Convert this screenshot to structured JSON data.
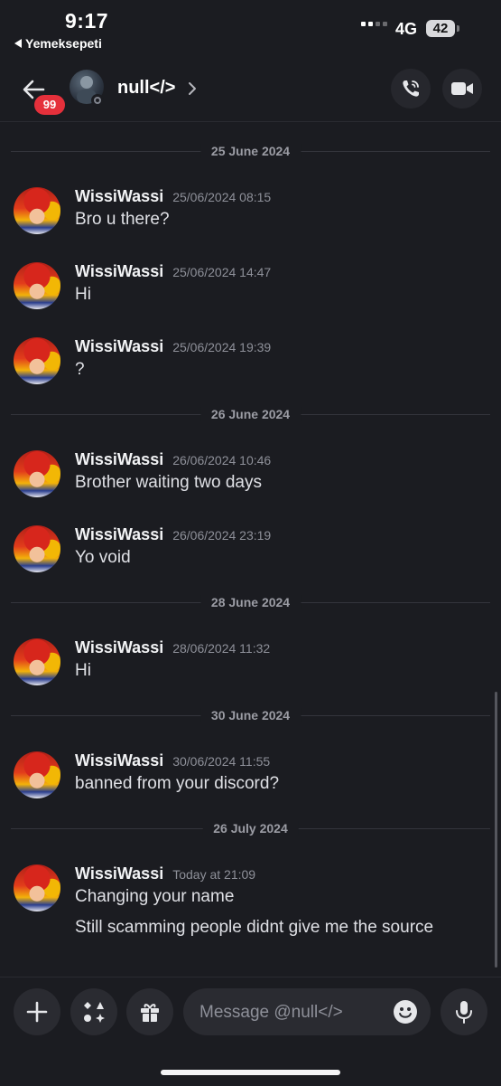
{
  "status_bar": {
    "time": "9:17",
    "back_app": "Yemeksepeti",
    "network": "4G",
    "battery": "42"
  },
  "header": {
    "badge_count": "99",
    "username": "null</>"
  },
  "messages": [
    {
      "type": "date",
      "label": "25 June 2024"
    },
    {
      "type": "message",
      "author": "WissiWassi",
      "timestamp": "25/06/2024 08:15",
      "lines": [
        "Bro u there?"
      ]
    },
    {
      "type": "message",
      "author": "WissiWassi",
      "timestamp": "25/06/2024 14:47",
      "lines": [
        "Hi"
      ]
    },
    {
      "type": "message",
      "author": "WissiWassi",
      "timestamp": "25/06/2024 19:39",
      "lines": [
        "?"
      ]
    },
    {
      "type": "date",
      "label": "26 June 2024"
    },
    {
      "type": "message",
      "author": "WissiWassi",
      "timestamp": "26/06/2024 10:46",
      "lines": [
        "Brother waiting two days"
      ]
    },
    {
      "type": "message",
      "author": "WissiWassi",
      "timestamp": "26/06/2024 23:19",
      "lines": [
        "Yo void"
      ]
    },
    {
      "type": "date",
      "label": "28 June 2024"
    },
    {
      "type": "message",
      "author": "WissiWassi",
      "timestamp": "28/06/2024 11:32",
      "lines": [
        "Hi"
      ]
    },
    {
      "type": "date",
      "label": "30 June 2024"
    },
    {
      "type": "message",
      "author": "WissiWassi",
      "timestamp": "30/06/2024 11:55",
      "lines": [
        "banned from your discord?"
      ]
    },
    {
      "type": "date",
      "label": "26 July 2024"
    },
    {
      "type": "message",
      "author": "WissiWassi",
      "timestamp": "Today at 21:09",
      "lines": [
        "Changing your name",
        "Still scamming people didnt give me the source"
      ]
    }
  ],
  "composer": {
    "placeholder": "Message @null</>"
  },
  "icons": [
    "back-arrow-icon",
    "chevron-right-icon",
    "phone-call-icon",
    "video-camera-icon",
    "plus-icon",
    "apps-icon",
    "gift-icon",
    "emoji-icon",
    "microphone-icon"
  ],
  "colors": {
    "background": "#1b1c21",
    "badge": "#e5303b",
    "surface": "#2a2b31"
  }
}
